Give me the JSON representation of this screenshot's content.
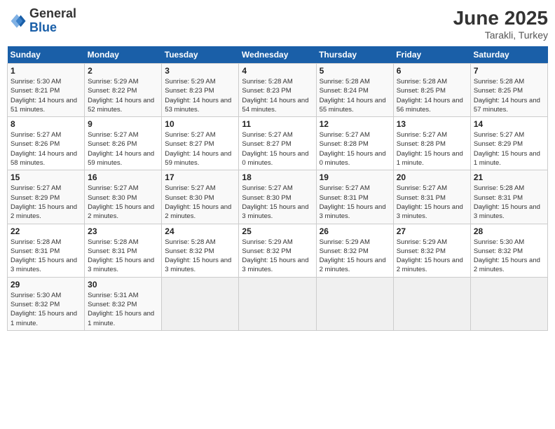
{
  "header": {
    "logo_general": "General",
    "logo_blue": "Blue",
    "month_title": "June 2025",
    "location": "Tarakli, Turkey"
  },
  "days_of_week": [
    "Sunday",
    "Monday",
    "Tuesday",
    "Wednesday",
    "Thursday",
    "Friday",
    "Saturday"
  ],
  "weeks": [
    [
      {
        "day": "1",
        "sunrise": "5:30 AM",
        "sunset": "8:21 PM",
        "daylight": "14 hours and 51 minutes."
      },
      {
        "day": "2",
        "sunrise": "5:29 AM",
        "sunset": "8:22 PM",
        "daylight": "14 hours and 52 minutes."
      },
      {
        "day": "3",
        "sunrise": "5:29 AM",
        "sunset": "8:23 PM",
        "daylight": "14 hours and 53 minutes."
      },
      {
        "day": "4",
        "sunrise": "5:28 AM",
        "sunset": "8:23 PM",
        "daylight": "14 hours and 54 minutes."
      },
      {
        "day": "5",
        "sunrise": "5:28 AM",
        "sunset": "8:24 PM",
        "daylight": "14 hours and 55 minutes."
      },
      {
        "day": "6",
        "sunrise": "5:28 AM",
        "sunset": "8:25 PM",
        "daylight": "14 hours and 56 minutes."
      },
      {
        "day": "7",
        "sunrise": "5:28 AM",
        "sunset": "8:25 PM",
        "daylight": "14 hours and 57 minutes."
      }
    ],
    [
      {
        "day": "8",
        "sunrise": "5:27 AM",
        "sunset": "8:26 PM",
        "daylight": "14 hours and 58 minutes."
      },
      {
        "day": "9",
        "sunrise": "5:27 AM",
        "sunset": "8:26 PM",
        "daylight": "14 hours and 59 minutes."
      },
      {
        "day": "10",
        "sunrise": "5:27 AM",
        "sunset": "8:27 PM",
        "daylight": "14 hours and 59 minutes."
      },
      {
        "day": "11",
        "sunrise": "5:27 AM",
        "sunset": "8:27 PM",
        "daylight": "15 hours and 0 minutes."
      },
      {
        "day": "12",
        "sunrise": "5:27 AM",
        "sunset": "8:28 PM",
        "daylight": "15 hours and 0 minutes."
      },
      {
        "day": "13",
        "sunrise": "5:27 AM",
        "sunset": "8:28 PM",
        "daylight": "15 hours and 1 minute."
      },
      {
        "day": "14",
        "sunrise": "5:27 AM",
        "sunset": "8:29 PM",
        "daylight": "15 hours and 1 minute."
      }
    ],
    [
      {
        "day": "15",
        "sunrise": "5:27 AM",
        "sunset": "8:29 PM",
        "daylight": "15 hours and 2 minutes."
      },
      {
        "day": "16",
        "sunrise": "5:27 AM",
        "sunset": "8:30 PM",
        "daylight": "15 hours and 2 minutes."
      },
      {
        "day": "17",
        "sunrise": "5:27 AM",
        "sunset": "8:30 PM",
        "daylight": "15 hours and 2 minutes."
      },
      {
        "day": "18",
        "sunrise": "5:27 AM",
        "sunset": "8:30 PM",
        "daylight": "15 hours and 3 minutes."
      },
      {
        "day": "19",
        "sunrise": "5:27 AM",
        "sunset": "8:31 PM",
        "daylight": "15 hours and 3 minutes."
      },
      {
        "day": "20",
        "sunrise": "5:27 AM",
        "sunset": "8:31 PM",
        "daylight": "15 hours and 3 minutes."
      },
      {
        "day": "21",
        "sunrise": "5:28 AM",
        "sunset": "8:31 PM",
        "daylight": "15 hours and 3 minutes."
      }
    ],
    [
      {
        "day": "22",
        "sunrise": "5:28 AM",
        "sunset": "8:31 PM",
        "daylight": "15 hours and 3 minutes."
      },
      {
        "day": "23",
        "sunrise": "5:28 AM",
        "sunset": "8:31 PM",
        "daylight": "15 hours and 3 minutes."
      },
      {
        "day": "24",
        "sunrise": "5:28 AM",
        "sunset": "8:32 PM",
        "daylight": "15 hours and 3 minutes."
      },
      {
        "day": "25",
        "sunrise": "5:29 AM",
        "sunset": "8:32 PM",
        "daylight": "15 hours and 3 minutes."
      },
      {
        "day": "26",
        "sunrise": "5:29 AM",
        "sunset": "8:32 PM",
        "daylight": "15 hours and 2 minutes."
      },
      {
        "day": "27",
        "sunrise": "5:29 AM",
        "sunset": "8:32 PM",
        "daylight": "15 hours and 2 minutes."
      },
      {
        "day": "28",
        "sunrise": "5:30 AM",
        "sunset": "8:32 PM",
        "daylight": "15 hours and 2 minutes."
      }
    ],
    [
      {
        "day": "29",
        "sunrise": "5:30 AM",
        "sunset": "8:32 PM",
        "daylight": "15 hours and 1 minute."
      },
      {
        "day": "30",
        "sunrise": "5:31 AM",
        "sunset": "8:32 PM",
        "daylight": "15 hours and 1 minute."
      },
      null,
      null,
      null,
      null,
      null
    ]
  ]
}
